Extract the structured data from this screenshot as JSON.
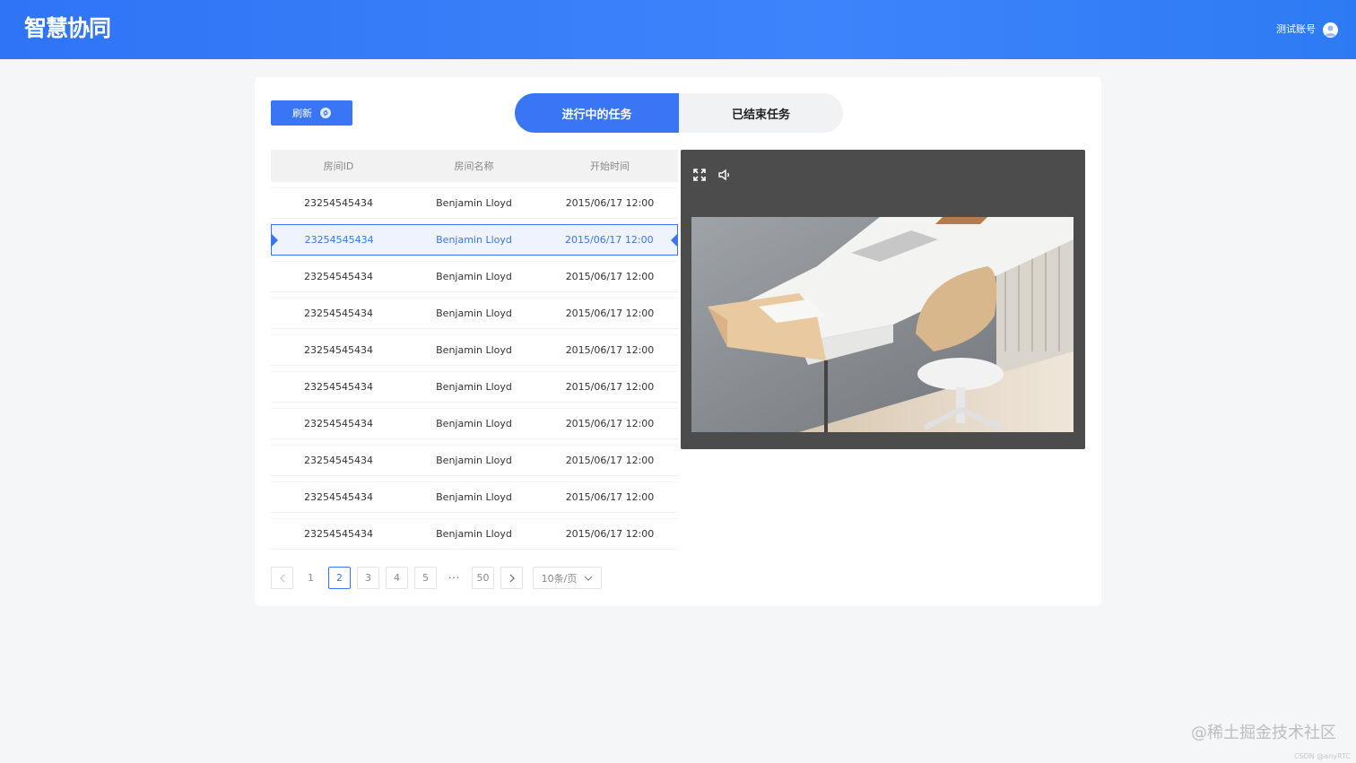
{
  "header": {
    "logo": "智慧协同",
    "account_name": "测试账号"
  },
  "toolbar": {
    "refresh_label": "刷新"
  },
  "tabs": [
    {
      "label": "进行中的任务",
      "active": true
    },
    {
      "label": "已结束任务",
      "active": false
    }
  ],
  "table": {
    "columns": [
      "房间ID",
      "房间名称",
      "开始时间"
    ],
    "rows": [
      {
        "id": "23254545434",
        "name": "Benjamin Lloyd",
        "time": "2015/06/17 12:00",
        "selected": false
      },
      {
        "id": "23254545434",
        "name": "Benjamin Lloyd",
        "time": "2015/06/17 12:00",
        "selected": true
      },
      {
        "id": "23254545434",
        "name": "Benjamin Lloyd",
        "time": "2015/06/17 12:00",
        "selected": false
      },
      {
        "id": "23254545434",
        "name": "Benjamin Lloyd",
        "time": "2015/06/17 12:00",
        "selected": false
      },
      {
        "id": "23254545434",
        "name": "Benjamin Lloyd",
        "time": "2015/06/17 12:00",
        "selected": false
      },
      {
        "id": "23254545434",
        "name": "Benjamin Lloyd",
        "time": "2015/06/17 12:00",
        "selected": false
      },
      {
        "id": "23254545434",
        "name": "Benjamin Lloyd",
        "time": "2015/06/17 12:00",
        "selected": false
      },
      {
        "id": "23254545434",
        "name": "Benjamin Lloyd",
        "time": "2015/06/17 12:00",
        "selected": false
      },
      {
        "id": "23254545434",
        "name": "Benjamin Lloyd",
        "time": "2015/06/17 12:00",
        "selected": false
      },
      {
        "id": "23254545434",
        "name": "Benjamin Lloyd",
        "time": "2015/06/17 12:00",
        "selected": false
      }
    ]
  },
  "pagination": {
    "pages": [
      "1",
      "2",
      "3",
      "4",
      "5",
      "···",
      "50"
    ],
    "current": "2",
    "page_size": "10条/页"
  },
  "video": {
    "controls": [
      "fullscreen-icon",
      "speaker-icon"
    ]
  },
  "watermark": {
    "text": "@稀土掘金技术社区",
    "small": "CSDN @anyRTC"
  },
  "colors": {
    "primary": "#3876f6",
    "header": "#2f74f5",
    "video_bg": "#4c4c4c"
  }
}
